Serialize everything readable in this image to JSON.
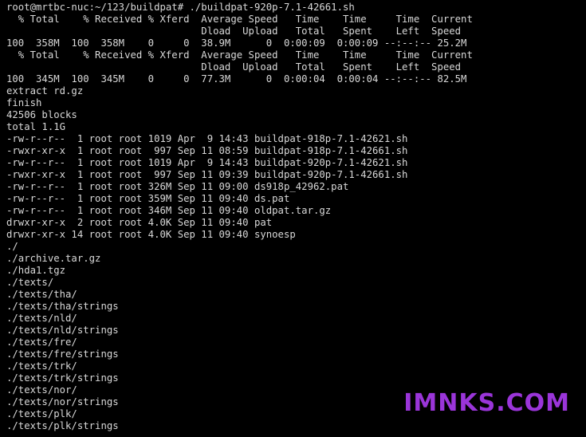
{
  "terminal": {
    "colors": {
      "background": "#000000",
      "text": "#d8d8d8",
      "watermark": "#9a35d9"
    },
    "lines": [
      "root@mrtbc-nuc:~/123/buildpat# ./buildpat-920p-7.1-42661.sh",
      "  % Total    % Received % Xferd  Average Speed   Time    Time     Time  Current",
      "                                 Dload  Upload   Total   Spent    Left  Speed",
      "100  358M  100  358M    0     0  38.9M      0  0:00:09  0:00:09 --:--:-- 25.2M",
      "  % Total    % Received % Xferd  Average Speed   Time    Time     Time  Current",
      "                                 Dload  Upload   Total   Spent    Left  Speed",
      "100  345M  100  345M    0     0  77.3M      0  0:00:04  0:00:04 --:--:-- 82.5M",
      "extract rd.gz",
      "finish",
      "42506 blocks",
      "total 1.1G",
      "-rw-r--r--  1 root root 1019 Apr  9 14:43 buildpat-918p-7.1-42621.sh",
      "-rwxr-xr-x  1 root root  997 Sep 11 08:59 buildpat-918p-7.1-42661.sh",
      "-rw-r--r--  1 root root 1019 Apr  9 14:43 buildpat-920p-7.1-42621.sh",
      "-rwxr-xr-x  1 root root  997 Sep 11 09:39 buildpat-920p-7.1-42661.sh",
      "-rw-r--r--  1 root root 326M Sep 11 09:00 ds918p_42962.pat",
      "-rw-r--r--  1 root root 359M Sep 11 09:40 ds.pat",
      "-rw-r--r--  1 root root 346M Sep 11 09:40 oldpat.tar.gz",
      "drwxr-xr-x  2 root root 4.0K Sep 11 09:40 pat",
      "drwxr-xr-x 14 root root 4.0K Sep 11 09:40 synoesp",
      "./",
      "./archive.tar.gz",
      "./hda1.tgz",
      "./texts/",
      "./texts/tha/",
      "./texts/tha/strings",
      "./texts/nld/",
      "./texts/nld/strings",
      "./texts/fre/",
      "./texts/fre/strings",
      "./texts/trk/",
      "./texts/trk/strings",
      "./texts/nor/",
      "./texts/nor/strings",
      "./texts/plk/",
      "./texts/plk/strings"
    ]
  },
  "watermark": {
    "text": "IMNKS.COM"
  }
}
